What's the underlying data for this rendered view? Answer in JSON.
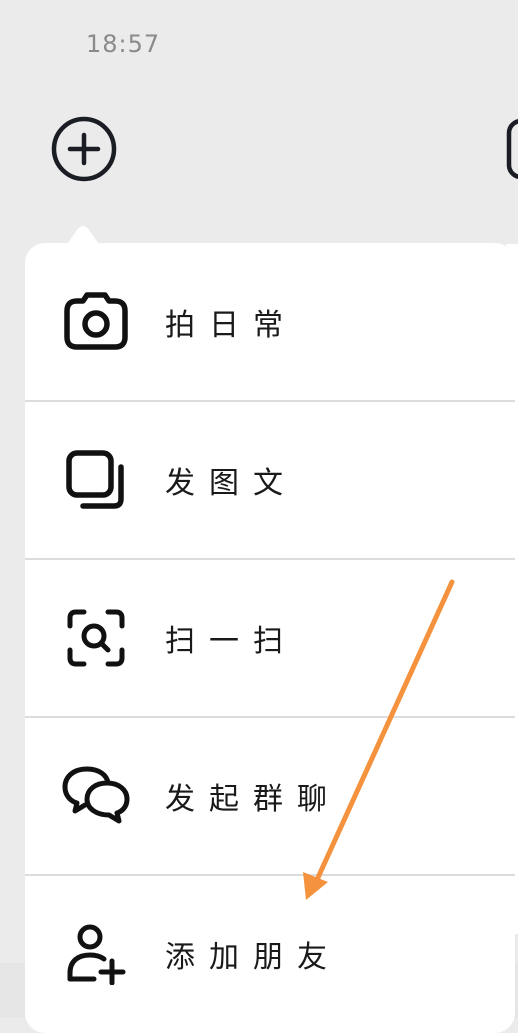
{
  "status_bar": {
    "time": "18:57"
  },
  "menu": {
    "items": [
      {
        "label": "拍日常",
        "icon": "camera-icon"
      },
      {
        "label": "发图文",
        "icon": "layers-icon"
      },
      {
        "label": "扫一扫",
        "icon": "scan-icon"
      },
      {
        "label": "发起群聊",
        "icon": "chat-bubbles-icon"
      },
      {
        "label": "添加朋友",
        "icon": "add-user-icon"
      }
    ]
  },
  "colors": {
    "accent_arrow": "#f5923e",
    "icon": "#111111"
  }
}
